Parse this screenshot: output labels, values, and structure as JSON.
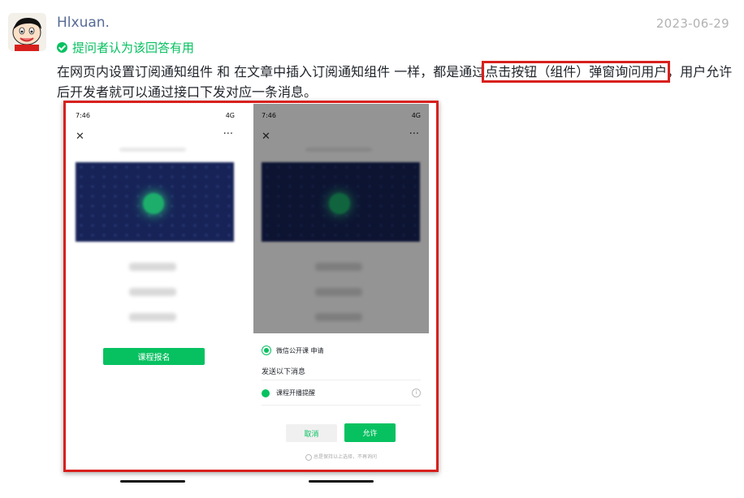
{
  "user": {
    "name": "Hlxuan."
  },
  "post": {
    "date": "2023-06-29",
    "accepted_label": "提问者认为该回答有用"
  },
  "answer": {
    "part1": "在网页内设置订阅通知组件 和 在文章中插入订阅通知组件 一样，都是通过",
    "highlight": "点击按钮（组件）弹窗询问用户",
    "part2": "，用户允许后开发者就可以通过接口下发对应一条消息。"
  },
  "phone_left": {
    "time": "7:46",
    "signal": "4G",
    "enroll_button": "课程报名"
  },
  "phone_right": {
    "time": "7:46",
    "signal": "4G",
    "app_name": "微信公开课 申请",
    "sheet_title": "发送以下消息",
    "item": "课程开播提醒",
    "cancel": "取消",
    "allow": "允许",
    "remember": "总是保持以上选择，不再询问"
  },
  "colors": {
    "accent_green": "#07c160",
    "link_blue": "#576b95",
    "highlight_red": "#d8201d"
  }
}
